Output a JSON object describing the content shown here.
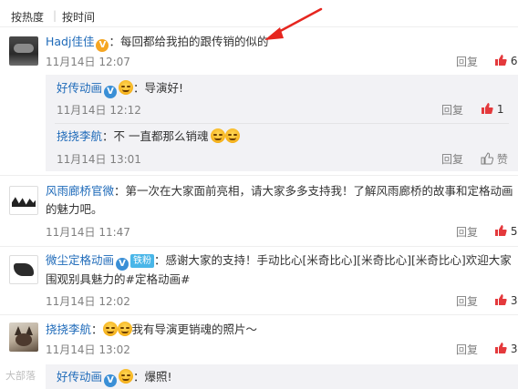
{
  "sort": {
    "by_hot": "按热度",
    "sep": "|",
    "by_time": "按时间"
  },
  "comments": [
    {
      "author": "Hadj佳佳",
      "colon": "：",
      "text": "每回都给我拍的跟传销的似的",
      "time": "11月14日 12:07",
      "reply": "回复",
      "likes": "6",
      "replies": [
        {
          "author": "好传动画",
          "colon": "：",
          "text": "导演好!",
          "time": "11月14日 12:12",
          "reply": "回复",
          "likes": "1"
        },
        {
          "author": "挠挠李航",
          "colon": "：",
          "text": "不 一直都那么销魂",
          "time": "11月14日 13:01",
          "reply": "回复",
          "likes": "赞"
        }
      ]
    },
    {
      "author": "风雨廊桥官微",
      "colon": "：",
      "text": "第一次在大家面前亮相，请大家多多支持我！了解风雨廊桥的故事和定格动画的魅力吧。",
      "time": "11月14日 11:47",
      "reply": "回复",
      "likes": "5"
    },
    {
      "author": "微尘定格动画",
      "fan_badge": "铁粉",
      "colon": "：",
      "text": "感谢大家的支持！手动比心[米奇比心][米奇比心][米奇比心]欢迎大家围观别具魅力的#定格动画#",
      "time": "11月14日 12:02",
      "reply": "回复",
      "likes": "3"
    },
    {
      "author": "挠挠李航",
      "colon": "：",
      "text": "我有导演更销魂的照片～",
      "time": "11月14日 13:02",
      "reply": "回复",
      "likes": "3"
    },
    {
      "author": "好传动画",
      "colon": "：",
      "text": "爆照!"
    }
  ],
  "watermark": "大部落",
  "icons": {
    "v_badge": "V",
    "thumb": "thumb-up-icon",
    "arrow": "red-arrow-annotation"
  },
  "colors": {
    "author": "#eb7350",
    "author_blue": "#1e6ab9",
    "like_red": "#e4393c",
    "arrow": "#e6261f",
    "reply_bg": "#f2f2f5"
  }
}
